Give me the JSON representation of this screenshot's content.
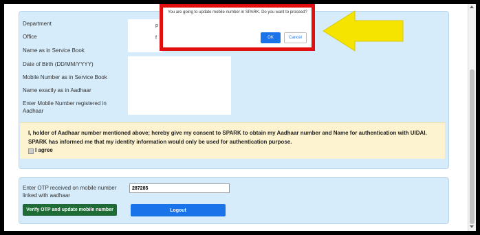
{
  "form": {
    "fields": [
      {
        "label": "Department",
        "value_fragment": "p"
      },
      {
        "label": "Office",
        "value_fragment": "f"
      },
      {
        "label": "Name as in Service Book"
      },
      {
        "label": "Date of Birth (DD/MM/YYYY)"
      },
      {
        "label": "Mobile Number as in Service Book"
      },
      {
        "label": "Name exactly as in Aadhaar"
      },
      {
        "label": "Enter Mobile Number registered in Aadhaar"
      }
    ]
  },
  "consent": {
    "text": "I, holder of Aadhaar number mentioned above; hereby give my consent to SPARK to obtain my Aadhaar number and Name for authentication with UIDAI. SPARK has informed me that my identity information would only be used for authentication purpose.",
    "agree_label": "I agree",
    "checked": true
  },
  "otp": {
    "label": "Enter OTP received on mobile number linked with aadhaar",
    "value": "287285"
  },
  "buttons": {
    "verify": "Verify OTP and update mobile number",
    "logout": "Logout"
  },
  "dialog": {
    "message": "You are going to update mobile number in SPARK. Do you want to proceed?",
    "ok": "OK",
    "cancel": "Cancel"
  },
  "colors": {
    "panel": "#d6ecfb",
    "consent_bg": "#fdf3d0",
    "verify_button": "#1e6b36",
    "primary": "#1a73e8",
    "highlight_border": "#e01010",
    "arrow": "#f5e400"
  }
}
